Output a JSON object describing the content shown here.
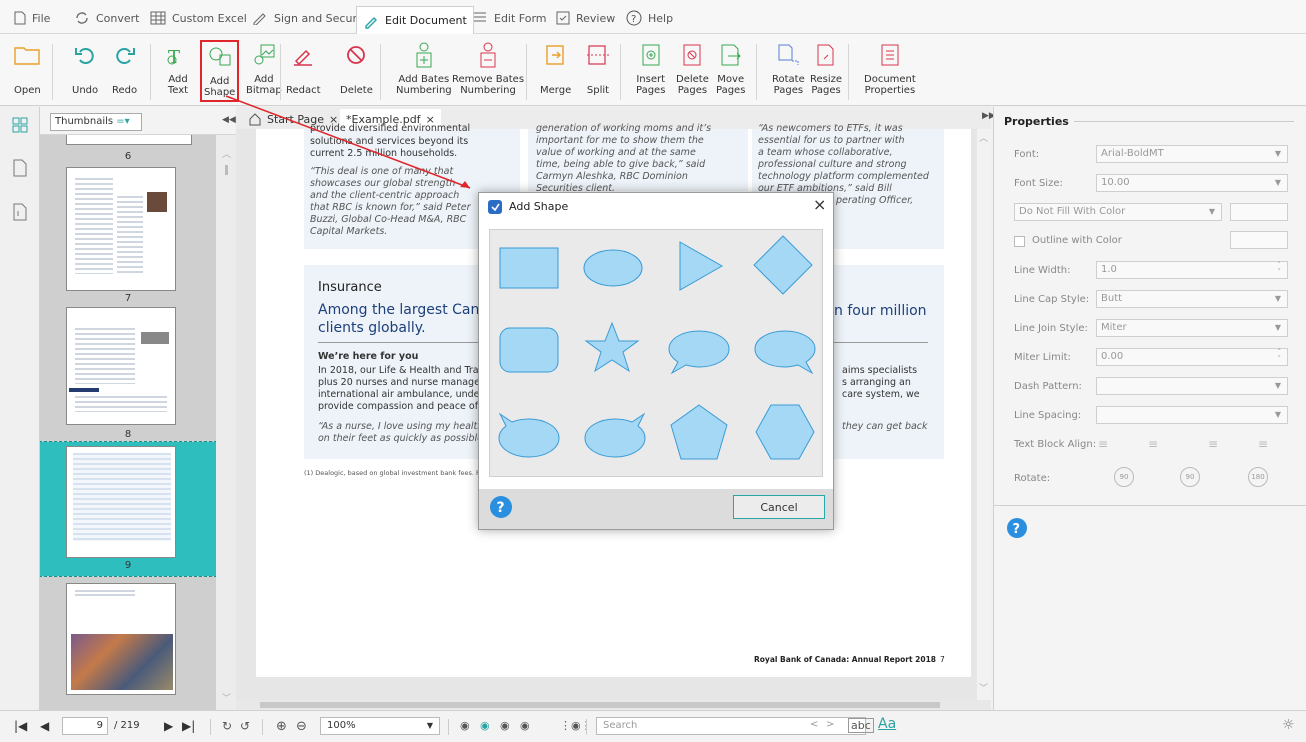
{
  "menubar": {
    "items": [
      "File",
      "Convert",
      "Custom Excel",
      "Sign and Secure",
      "Edit Document",
      "Edit Form",
      "Review",
      "Help"
    ],
    "active": "Edit Document"
  },
  "ribbon": {
    "open": "Open",
    "undo": "Undo",
    "redo": "Redo",
    "add_text": [
      "Add",
      "Text"
    ],
    "add_shape": [
      "Add",
      "Shape"
    ],
    "add_bitmap": [
      "Add",
      "Bitmap"
    ],
    "redact": "Redact",
    "delete": "Delete",
    "add_bates": [
      "Add Bates",
      "Numbering"
    ],
    "remove_bates": [
      "Remove Bates",
      "Numbering"
    ],
    "merge": "Merge",
    "split": "Split",
    "insert_pages": [
      "Insert",
      "Pages"
    ],
    "delete_pages": [
      "Delete",
      "Pages"
    ],
    "move_pages": [
      "Move",
      "Pages"
    ],
    "rotate_pages": [
      "Rotate",
      "Pages"
    ],
    "resize_pages": [
      "Resize",
      "Pages"
    ],
    "doc_props": [
      "Document",
      "Properties"
    ]
  },
  "thumbs": {
    "selector": "Thumbnails",
    "pages": [
      "6",
      "7",
      "8",
      "9"
    ]
  },
  "tabs": {
    "start": "Start Page",
    "doc": "*Example.pdf"
  },
  "doc": {
    "col1_top": [
      "provide diversified environmental",
      "solutions and services beyond its",
      "current 2.5 million households."
    ],
    "col1_quote": [
      "“This deal is one of many that",
      "showcases our global strength",
      "and the client-centric approach",
      "that RBC is known for,” said Peter",
      "Buzzi, Global Co-Head M&A, RBC",
      "Capital Markets."
    ],
    "col2_top": [
      "generation of working moms and it’s",
      "important for me to show them the",
      "value of working and at the same",
      "time, being able to give back,” said",
      "Carmyn Aleshka, RBC Dominion",
      "Securities client."
    ],
    "col3_top": [
      "“As newcomers to ETFs, it was",
      "essential for us to partner with",
      "a team whose collaborative,",
      "professional culture and strong",
      "technology platform complemented",
      "our ETF ambitions,” said Bill",
      "perating Officer,"
    ],
    "ins_title": "Insurance",
    "ins_head1": "Among the largest Canadi",
    "ins_head2": "clients globally.",
    "ins_head_r": "n four million",
    "ins_sub": "We’re here for you",
    "ins_body": [
      "In 2018, our Life & Health and Trav",
      "plus 20 nurses and nurse manager",
      "international air ambulance, unde",
      "provide compassion and peace of"
    ],
    "ins_body_r": [
      "aims specialists",
      "s arranging an",
      "care system, we"
    ],
    "ins_quote": [
      "“As a nurse, I love using my healthc",
      "on their feet as quickly as possible,"
    ],
    "ins_quote_r": "they can get back",
    "footnote": "(1)  Dealogic, based on global investment bank fees. Fiscal 20",
    "footer": "Royal Bank of Canada: Annual Report 2018",
    "page_no": "7"
  },
  "dialog": {
    "title": "Add Shape",
    "cancel": "Cancel",
    "shapes": [
      "rectangle",
      "ellipse",
      "triangle",
      "diamond",
      "rounded-rectangle",
      "star",
      "speech-bubble-left",
      "speech-bubble-right",
      "cloud-bubble-left",
      "cloud-bubble-right",
      "pentagon",
      "hexagon"
    ]
  },
  "properties": {
    "title": "Properties",
    "font_label": "Font:",
    "font_value": "Arial-BoldMT",
    "font_size_label": "Font Size:",
    "font_size_value": "10.00",
    "fill_value": "Do Not Fill With Color",
    "outline_label": "Outline with Color",
    "line_width_label": "Line Width:",
    "line_width_value": "1.0",
    "line_cap_label": "Line Cap Style:",
    "line_cap_value": "Butt",
    "line_join_label": "Line Join Style:",
    "line_join_value": "Miter",
    "miter_label": "Miter Limit:",
    "miter_value": "0.00",
    "dash_label": "Dash Pattern:",
    "spacing_label": "Line Spacing:",
    "align_label": "Text Block Align:",
    "rotate_label": "Rotate:",
    "rotate_values": [
      "90",
      "90",
      "180"
    ]
  },
  "status": {
    "page_current": "9",
    "page_total": "/ 219",
    "zoom": "100%",
    "search_placeholder": "Search",
    "abc": "abc",
    "aa": "Aa"
  },
  "colors": {
    "accent": "#2aa3a3",
    "shape_fill": "#a4d8f4",
    "shape_stroke": "#3a9bd6",
    "highlight": "#e0262a"
  }
}
